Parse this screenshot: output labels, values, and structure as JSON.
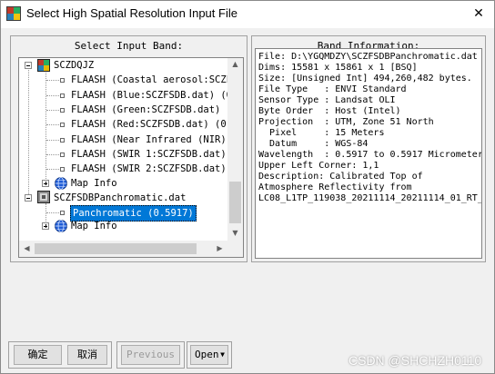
{
  "window": {
    "title": "Select High Spatial Resolution Input File",
    "close_glyph": "✕"
  },
  "left_panel": {
    "label": "Select Input Band:",
    "tree": {
      "file1": {
        "name": "SCZDQJZ",
        "bands": [
          "FLAASH (Coastal aerosol:SCZF",
          "FLAASH (Blue:SCZFSDB.dat) (0",
          "FLAASH (Green:SCZFSDB.dat) (",
          "FLAASH (Red:SCZFSDB.dat) (0.",
          "FLAASH (Near Infrared (NIR):",
          "FLAASH (SWIR 1:SCZFSDB.dat)",
          "FLAASH (SWIR 2:SCZFSDB.dat)"
        ],
        "map_info": "Map Info"
      },
      "file2": {
        "name": "SCZFSDBPanchromatic.dat",
        "bands": [
          "Panchromatic (0.5917)"
        ],
        "map_info": "Map Info"
      }
    }
  },
  "right_panel": {
    "label": "Band Information:",
    "lines": [
      "File: D:\\YGQMDZY\\SCZFSDBPanchromatic.dat",
      "Dims: 15581 x 15861 x 1 [BSQ]",
      "Size: [Unsigned Int] 494,260,482 bytes.",
      "File Type   : ENVI Standard",
      "Sensor Type : Landsat OLI",
      "Byte Order  : Host (Intel)",
      "Projection  : UTM, Zone 51 North",
      "  Pixel     : 15 Meters",
      "  Datum     : WGS-84",
      "Wavelength  : 0.5917 to 0.5917 Micrometers",
      "Upper Left Corner: 1,1",
      "Description: Calibrated Top of",
      "Atmosphere Reflectivity from",
      "LC08_L1TP_119038_20211114_20211114_01_RT_"
    ]
  },
  "buttons": {
    "ok": "确定",
    "cancel": "取消",
    "previous": "Previous",
    "open": "Open"
  },
  "icons": {
    "app": "envi-app-icon",
    "map": "globe-icon"
  },
  "watermark": "CSDN @SHCHZH0110"
}
